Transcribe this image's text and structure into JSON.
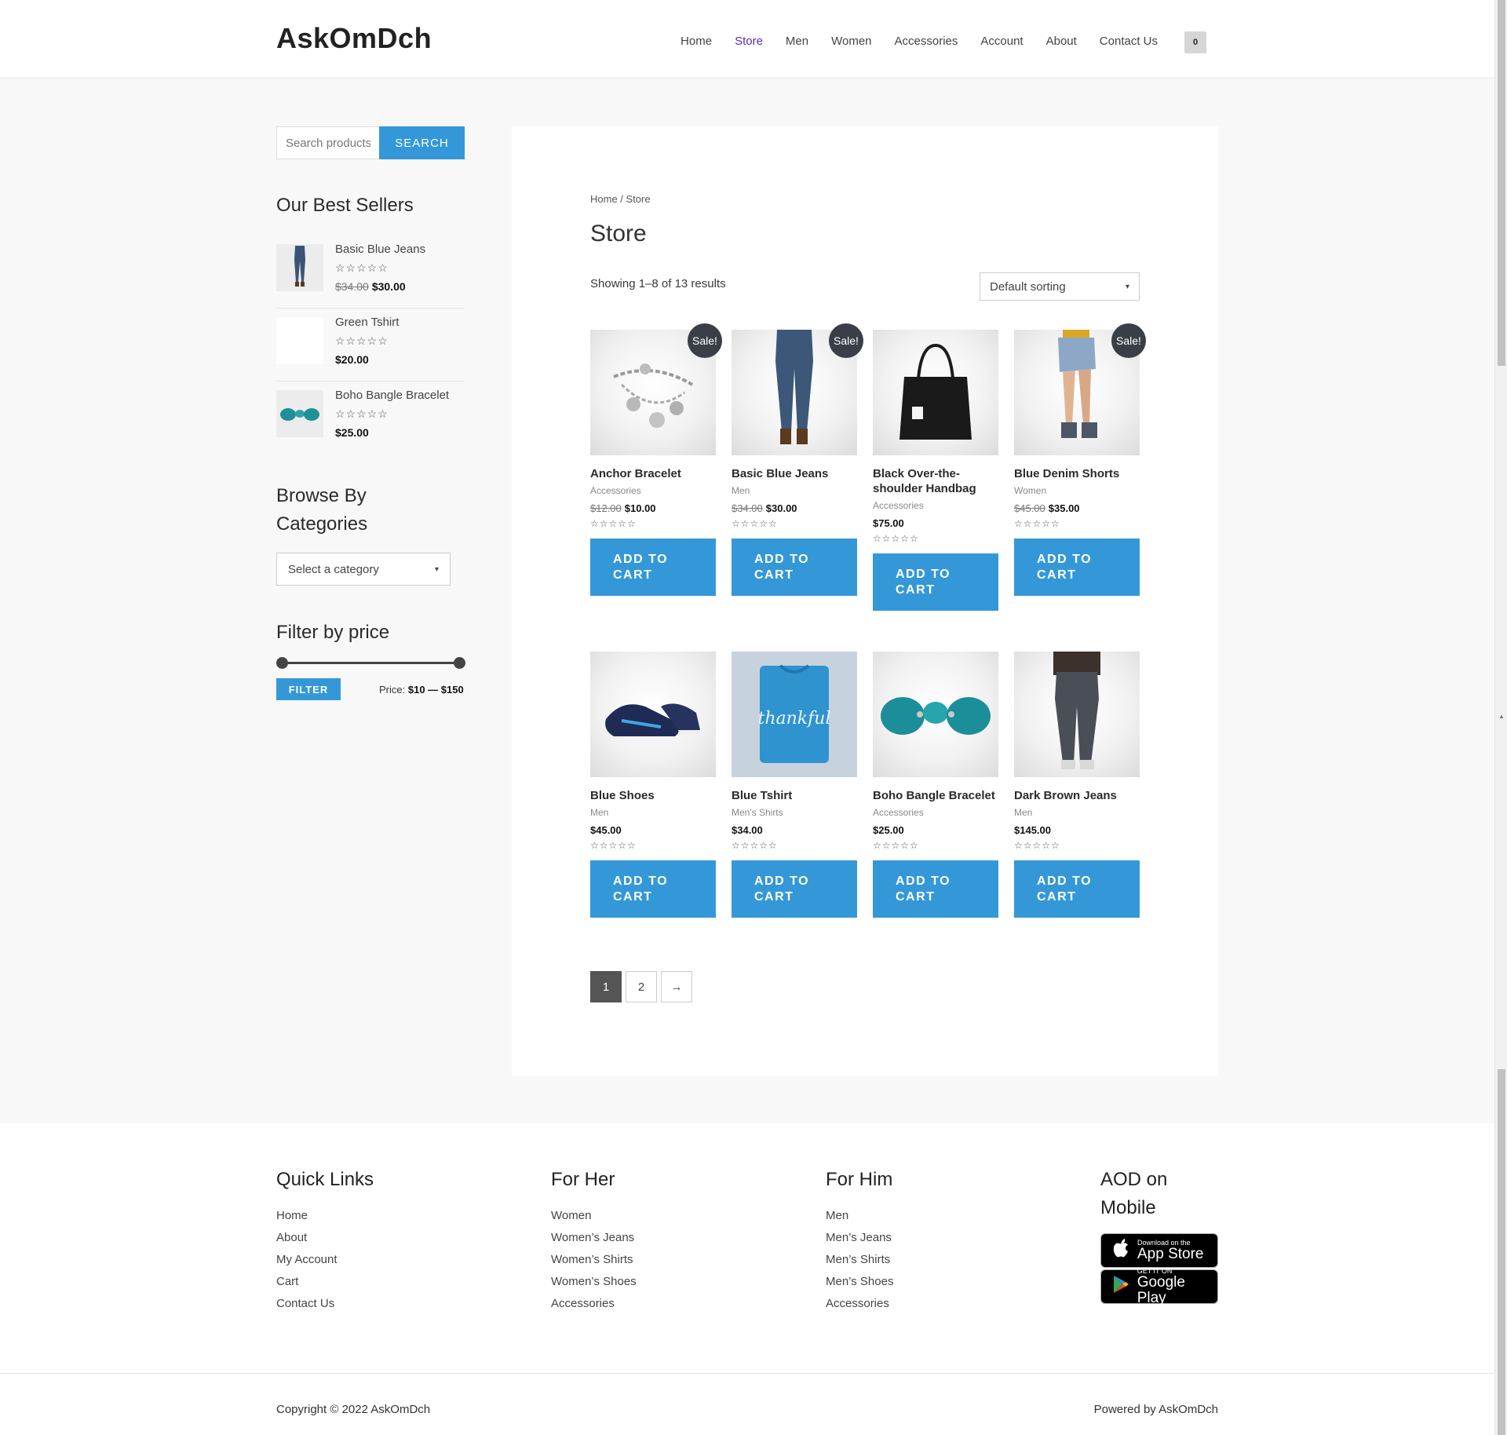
{
  "header": {
    "logo": "AskOmDch",
    "nav": [
      "Home",
      "Store",
      "Men",
      "Women",
      "Accessories",
      "Account",
      "About",
      "Contact Us"
    ],
    "active_nav": "Store",
    "cart_count": "0"
  },
  "sidebar": {
    "search_placeholder": "Search products…",
    "search_button": "SEARCH",
    "best_sellers_title": "Our Best Sellers",
    "best_sellers": [
      {
        "name": "Basic Blue Jeans",
        "stars": "☆☆☆☆☆",
        "old_price": "$34.00",
        "price": "$30.00"
      },
      {
        "name": "Green Tshirt",
        "stars": "☆☆☆☆☆",
        "old_price": "",
        "price": "$20.00"
      },
      {
        "name": "Boho Bangle Bracelet",
        "stars": "☆☆☆☆☆",
        "old_price": "",
        "price": "$25.00"
      }
    ],
    "categories_title_line1": "Browse By",
    "categories_title_line2": "Categories",
    "category_select": "Select a category",
    "price_filter_title": "Filter by price",
    "filter_button": "FILTER",
    "price_prefix": "Price:",
    "price_range": "$10 — $150"
  },
  "main": {
    "breadcrumb": "Home / Store",
    "title": "Store",
    "result_count": "Showing 1–8 of 13 results",
    "sort_select": "Default sorting",
    "add_to_cart_line1": "ADD TO",
    "add_to_cart_line2": "CART",
    "sale_label": "Sale!",
    "products": [
      {
        "name": "Anchor Bracelet",
        "category": "Accessories",
        "old_price": "$12.00",
        "price": "$10.00",
        "sale": true,
        "stars": "☆☆☆☆☆"
      },
      {
        "name": "Basic Blue Jeans",
        "category": "Men",
        "old_price": "$34.00",
        "price": "$30.00",
        "sale": true,
        "stars": "☆☆☆☆☆"
      },
      {
        "name": "Black Over-the-shoulder Handbag",
        "category": "Accessories",
        "old_price": "",
        "price": "$75.00",
        "sale": false,
        "stars": "☆☆☆☆☆"
      },
      {
        "name": "Blue Denim Shorts",
        "category": "Women",
        "old_price": "$45.00",
        "price": "$35.00",
        "sale": true,
        "stars": "☆☆☆☆☆"
      },
      {
        "name": "Blue Shoes",
        "category": "Men",
        "old_price": "",
        "price": "$45.00",
        "sale": false,
        "stars": "☆☆☆☆☆"
      },
      {
        "name": "Blue Tshirt",
        "category": "Men's Shirts",
        "old_price": "",
        "price": "$34.00",
        "sale": false,
        "stars": "☆☆☆☆☆"
      },
      {
        "name": "Boho Bangle Bracelet",
        "category": "Accessories",
        "old_price": "",
        "price": "$25.00",
        "sale": false,
        "stars": "☆☆☆☆☆"
      },
      {
        "name": "Dark Brown Jeans",
        "category": "Men",
        "old_price": "",
        "price": "$145.00",
        "sale": false,
        "stars": "☆☆☆☆☆"
      }
    ],
    "tshirt_print": "thankful",
    "pagination": [
      "1",
      "2",
      "→"
    ]
  },
  "footer": {
    "quick_links_title": "Quick Links",
    "quick_links": [
      "Home",
      "About",
      "My Account",
      "Cart",
      "Contact Us"
    ],
    "for_her_title": "For Her",
    "for_her": [
      "Women",
      "Women’s Jeans",
      "Women’s Shirts",
      "Women’s Shoes",
      "Accessories"
    ],
    "for_him_title": "For Him",
    "for_him": [
      "Men",
      "Men’s Jeans",
      "Men’s Shirts",
      "Men’s Shoes",
      "Accessories"
    ],
    "mobile_title_line1": "AOD on",
    "mobile_title_line2": "Mobile",
    "app_store_small": "Download on the",
    "app_store_big": "App Store",
    "google_play_small": "GET IT ON",
    "google_play_big": "Google Play",
    "copyright": "Copyright © 2022 AskOmDch",
    "powered": "Powered by AskOmDch"
  },
  "colors": {
    "accent": "#3498d8",
    "active_nav": "#5a2ea6",
    "sale_badge": "#3a3f47"
  }
}
